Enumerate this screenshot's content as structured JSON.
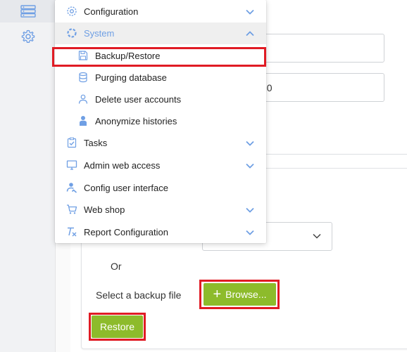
{
  "rail": {
    "items": [
      {
        "icon": "server-list-icon",
        "active": true
      },
      {
        "icon": "gear-icon",
        "active": false
      }
    ]
  },
  "form": {
    "field1_value": "",
    "field2_value": "20"
  },
  "restore_card": {
    "or_text": "Or",
    "file_label": "Select a backup file",
    "browse_label": "Browse...",
    "restore_label": "Restore"
  },
  "menu": {
    "items": [
      {
        "label": "Configuration",
        "icon": "gear-icon",
        "chevron": "down"
      },
      {
        "label": "System",
        "icon": "system-icon",
        "chevron": "up",
        "expanded": true
      },
      {
        "label": "Backup/Restore",
        "icon": "save-icon",
        "sub": true,
        "highlighted": true
      },
      {
        "label": "Purging database",
        "icon": "database-icon",
        "sub": true
      },
      {
        "label": "Delete user accounts",
        "icon": "user-icon",
        "sub": true
      },
      {
        "label": "Anonymize histories",
        "icon": "person-icon",
        "sub": true
      },
      {
        "label": "Tasks",
        "icon": "clipboard-check-icon",
        "chevron": "down"
      },
      {
        "label": "Admin web access",
        "icon": "monitor-icon",
        "chevron": "down"
      },
      {
        "label": "Config user interface",
        "icon": "user-config-icon"
      },
      {
        "label": "Web shop",
        "icon": "cart-icon",
        "chevron": "down"
      },
      {
        "label": "Report Configuration",
        "icon": "clear-format-icon",
        "chevron": "down"
      }
    ]
  },
  "colors": {
    "accent_blue": "#6f9fe4",
    "button_green": "#8dbb2b",
    "highlight_red": "#e01b24"
  }
}
